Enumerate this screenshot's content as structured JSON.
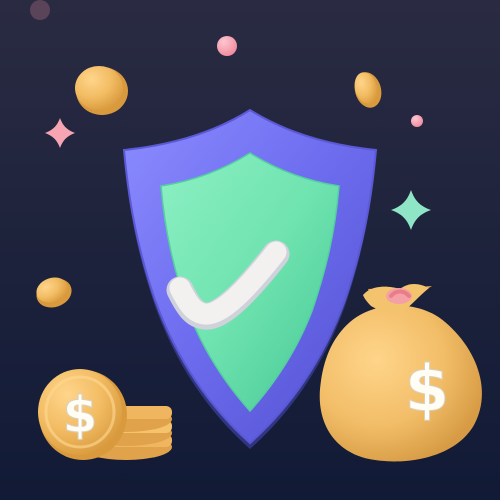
{
  "scene": {
    "background_colors": [
      "#25263d",
      "#111a36"
    ],
    "shield": {
      "icon": "shield-check-icon",
      "outer_color": "#6f6ef0",
      "inner_color": "#6fe3b0",
      "check_color": "#f2f1ef"
    },
    "money_bag": {
      "icon": "money-bag-icon",
      "color": "#f3c36e",
      "tie_color": "#f4a0a6",
      "symbol": "$"
    },
    "coin_stack": {
      "icon": "coin-stack-icon",
      "color": "#f0b65f",
      "symbol": "$"
    },
    "decorations": {
      "sparkle_colors": [
        "#f7a5b3",
        "#8ee6c7"
      ],
      "dot_color": "#f6a2b3",
      "coin_color": "#f1bc68"
    }
  }
}
